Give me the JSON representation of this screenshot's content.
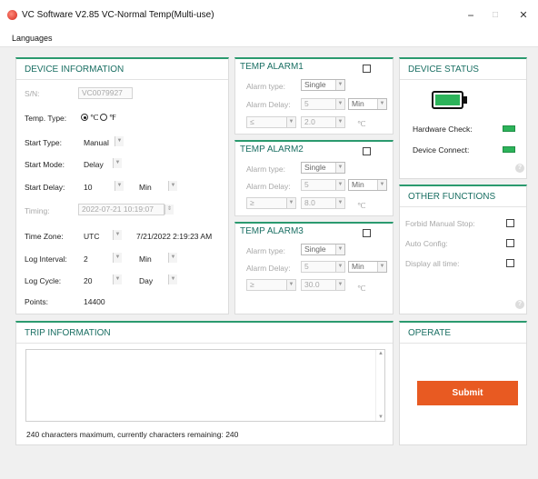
{
  "window": {
    "title": "VC Software V2.85 VC-Normal Temp(Multi-use)",
    "minimize": "−",
    "maximize": "□",
    "close": "✕"
  },
  "menu": {
    "languages": "Languages"
  },
  "device_info": {
    "title": "DEVICE INFORMATION",
    "sn_label": "S/N:",
    "sn_value": "VC0079927",
    "temp_type_label": "Temp. Type:",
    "celsius": "℃",
    "fahrenheit": "℉",
    "start_type_label": "Start Type:",
    "start_type_value": "Manual",
    "start_mode_label": "Start Mode:",
    "start_mode_value": "Delay",
    "start_delay_label": "Start Delay:",
    "start_delay_value": "10",
    "start_delay_unit": "Min",
    "timing_label": "Timing:",
    "timing_value": "2022-07-21 10:19:07",
    "time_zone_label": "Time Zone:",
    "time_zone_value": "UTC",
    "time_zone_time": "7/21/2022 2:19:23 AM",
    "log_interval_label": "Log Interval:",
    "log_interval_value": "2",
    "log_interval_unit": "Min",
    "log_cycle_label": "Log Cycle:",
    "log_cycle_value": "20",
    "log_cycle_unit": "Day",
    "points_label": "Points:",
    "points_value": "14400"
  },
  "alarm_labels": {
    "type": "Alarm type:",
    "delay": "Alarm Delay:",
    "unit": "℃"
  },
  "alarm1": {
    "title": "TEMP ALARM1",
    "type": "Single",
    "delay": "5",
    "delay_unit": "Min",
    "op": "≤",
    "threshold": "2.0"
  },
  "alarm2": {
    "title": "TEMP ALARM2",
    "type": "Single",
    "delay": "5",
    "delay_unit": "Min",
    "op": "≥",
    "threshold": "8.0"
  },
  "alarm3": {
    "title": "TEMP ALARM3",
    "type": "Single",
    "delay": "5",
    "delay_unit": "Min",
    "op": "≥",
    "threshold": "30.0"
  },
  "device_status": {
    "title": "DEVICE STATUS",
    "hardware_check": "Hardware Check:",
    "device_connect": "Device Connect:"
  },
  "other_functions": {
    "title": "OTHER FUNCTIONS",
    "forbid_manual_stop": "Forbid Manual Stop:",
    "auto_config": "Auto Config:",
    "display_all_time": "Display all time:"
  },
  "trip": {
    "title": "TRIP INFORMATION",
    "text": "",
    "counter": "240 characters maximum, currently characters remaining: 240"
  },
  "operate": {
    "title": "OPERATE",
    "submit": "Submit"
  },
  "colors": {
    "accent": "#2b9a6f",
    "title_text": "#1a6f63",
    "submit": "#e85a22",
    "status_ok": "#2cb35a"
  }
}
